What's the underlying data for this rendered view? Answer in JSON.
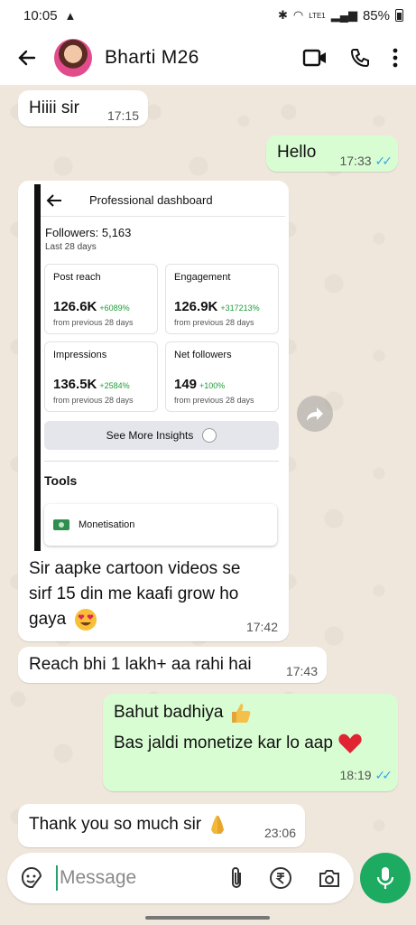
{
  "status_bar": {
    "time": "10:05",
    "warning_icon": "warning-icon",
    "network": "LTE1",
    "battery": "85%"
  },
  "header": {
    "contact_name": "Bharti M26",
    "icons": [
      "back-arrow-icon",
      "video-call-icon",
      "phone-icon",
      "more-vert-icon"
    ]
  },
  "messages": [
    {
      "dir": "in",
      "text": "Hiiii sir",
      "time": "17:15"
    },
    {
      "dir": "out",
      "text": "Hello",
      "time": "17:33",
      "read": true
    },
    {
      "dir": "in",
      "type": "image",
      "caption_line1": "Sir aapke cartoon videos se",
      "caption_line2": "sirf 15 din me kaafi grow ho",
      "caption_line3": "gaya",
      "emoji": "heart-eyes-emoji",
      "time": "17:42"
    },
    {
      "dir": "in",
      "text": "Reach bhi 1 lakh+ aa rahi hai",
      "time": "17:43"
    },
    {
      "dir": "out",
      "line1": "Bahut badhiya",
      "emoji1": "thumbs-up-emoji",
      "line2": "Bas jaldi monetize kar lo aap",
      "emoji2": "red-heart-emoji",
      "time": "18:19",
      "read": true
    },
    {
      "dir": "in",
      "text": "Thank you so much sir",
      "emoji": "folded-hands-emoji",
      "time": "23:06"
    }
  ],
  "dashboard": {
    "title": "Professional dashboard",
    "followers": "Followers: 5,163",
    "period": "Last 28 days",
    "cards": [
      {
        "label": "Post reach",
        "value": "126.6K",
        "change": "+6089%",
        "sub": "from previous 28 days"
      },
      {
        "label": "Engagement",
        "value": "126.9K",
        "change": "+317213%",
        "sub": "from previous 28 days"
      },
      {
        "label": "Impressions",
        "value": "136.5K",
        "change": "+2584%",
        "sub": "from previous 28 days"
      },
      {
        "label": "Net followers",
        "value": "149",
        "change": "+100%",
        "sub": "from previous 28 days"
      }
    ],
    "see_more": "See More Insights",
    "tools_heading": "Tools",
    "monetisation": "Monetisation"
  },
  "composer": {
    "placeholder": "Message",
    "icons": [
      "sticker-icon",
      "attach-icon",
      "rupee-payment-icon",
      "camera-icon",
      "mic-icon"
    ]
  },
  "colors": {
    "incoming_bubble": "#ffffff",
    "outgoing_bubble": "#d9fdd3",
    "read_ticks": "#34a6e8",
    "mic_button": "#1daa61",
    "chat_background": "#efe7dc"
  }
}
